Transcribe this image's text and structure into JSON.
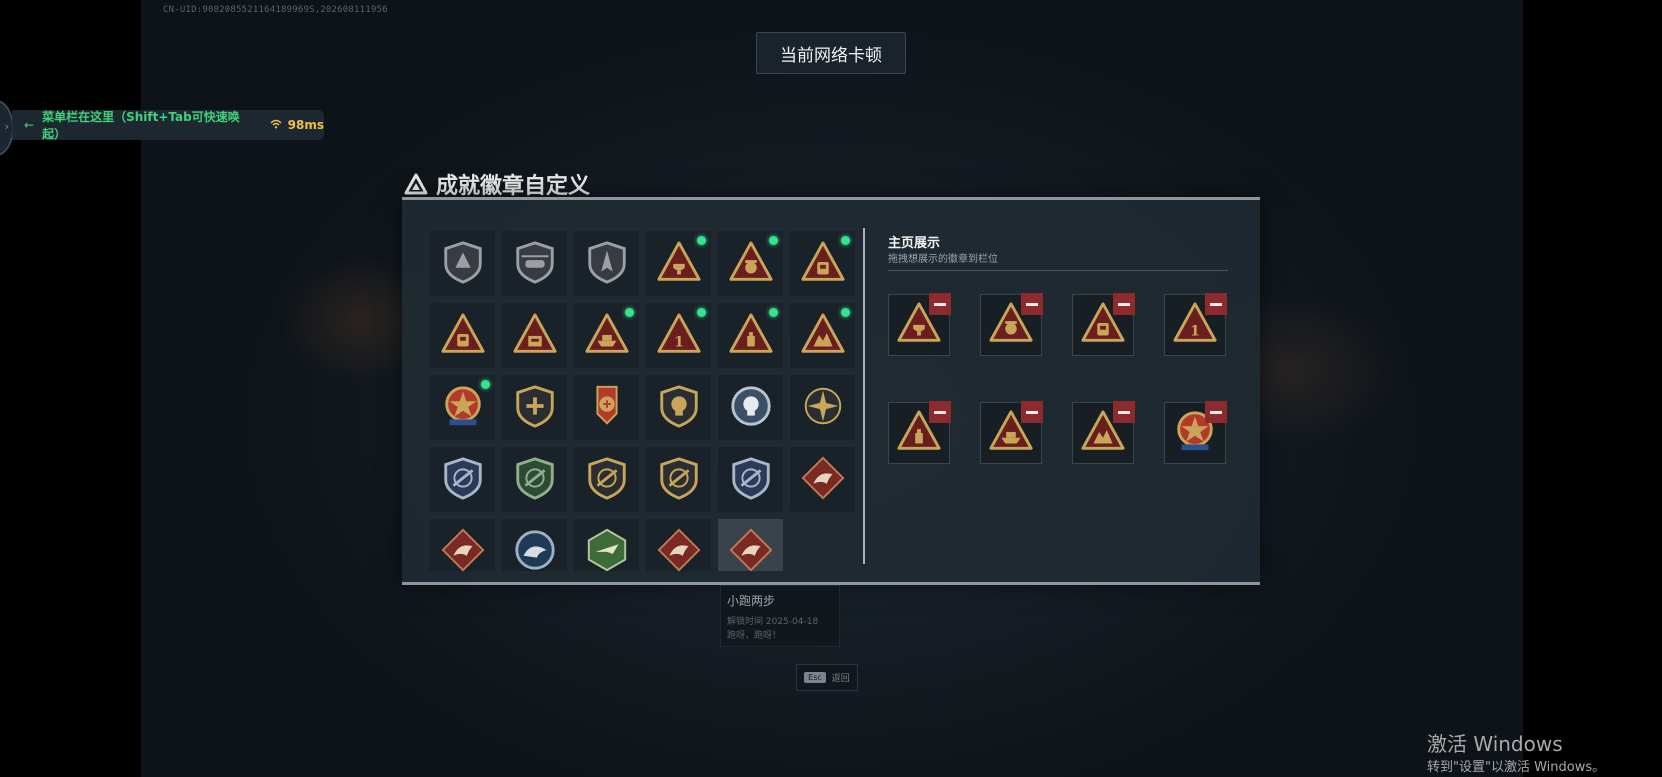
{
  "uid_text": "CN-UID:9082085521164189969S,202608111956",
  "toast": "当前网络卡顿",
  "menu_bar": {
    "hint": "菜单栏在这里（Shift+Tab可快速唤起）",
    "ping": "98ms"
  },
  "panel_title": "成就徽章自定义",
  "badge_grid": [
    {
      "icon": "mountain-shield-badge",
      "new": false
    },
    {
      "icon": "helicopter-shield-badge",
      "new": false
    },
    {
      "icon": "jet-shield-badge",
      "new": false
    },
    {
      "icon": "trophy-triangle-badge",
      "new": true
    },
    {
      "icon": "scale-triangle-badge",
      "new": true
    },
    {
      "icon": "backpack-triangle-badge",
      "new": true
    },
    {
      "icon": "backpack-triangle-badge",
      "new": false
    },
    {
      "icon": "box-triangle-badge",
      "new": false
    },
    {
      "icon": "boat-triangle-badge",
      "new": true
    },
    {
      "icon": "number-one-triangle-badge",
      "new": true
    },
    {
      "icon": "bottle-triangle-badge",
      "new": true
    },
    {
      "icon": "soldier-triangle-badge",
      "new": true
    },
    {
      "icon": "star-medal-badge",
      "new": true
    },
    {
      "icon": "plus-shield-badge",
      "new": false
    },
    {
      "icon": "cross-medal-badge",
      "new": false
    },
    {
      "icon": "lion-shield-badge",
      "new": false
    },
    {
      "icon": "skull-round-badge",
      "new": false
    },
    {
      "icon": "compass-round-badge",
      "new": false
    },
    {
      "icon": "rifle-crossed-badge",
      "new": false
    },
    {
      "icon": "rifle-green-badge",
      "new": false
    },
    {
      "icon": "rifle-shield-badge",
      "new": false
    },
    {
      "icon": "rifle-shield-badge",
      "new": false
    },
    {
      "icon": "rifle-blue-badge",
      "new": false
    },
    {
      "icon": "beast-diamond-badge",
      "new": false
    },
    {
      "icon": "beast-diamond-badge",
      "new": false
    },
    {
      "icon": "beast-round-badge",
      "new": false
    },
    {
      "icon": "plane-hexagon-badge",
      "new": false
    },
    {
      "icon": "beast-diamond-badge",
      "new": false
    },
    {
      "icon": "beast-diamond-badge",
      "new": false
    }
  ],
  "selected_index": 28,
  "showcase": {
    "title": "主页展示",
    "subtitle": "拖拽想展示的徽章到栏位",
    "slots": [
      {
        "icon": "trophy-triangle-badge"
      },
      {
        "icon": "scale-triangle-badge"
      },
      {
        "icon": "backpack-triangle-badge"
      },
      {
        "icon": "number-one-triangle-badge"
      },
      {
        "icon": "bottle-triangle-badge"
      },
      {
        "icon": "boat-triangle-badge"
      },
      {
        "icon": "soldier-triangle-badge"
      },
      {
        "icon": "star-medal-badge"
      }
    ]
  },
  "tooltip": {
    "name": "小跑两步",
    "date": "解锁时间  2025-04-18",
    "desc": "跑呀，跑呀！"
  },
  "back": {
    "key": "Esc",
    "label": "返回"
  },
  "watermark": {
    "line1": "激活 Windows",
    "line2": "转到\"设置\"以激活 Windows。"
  },
  "colors": {
    "new_dot": "#35e28e",
    "remove": "#8c2a2e",
    "gold": "#c9a55a",
    "badge_red": "#6b1e1e"
  }
}
